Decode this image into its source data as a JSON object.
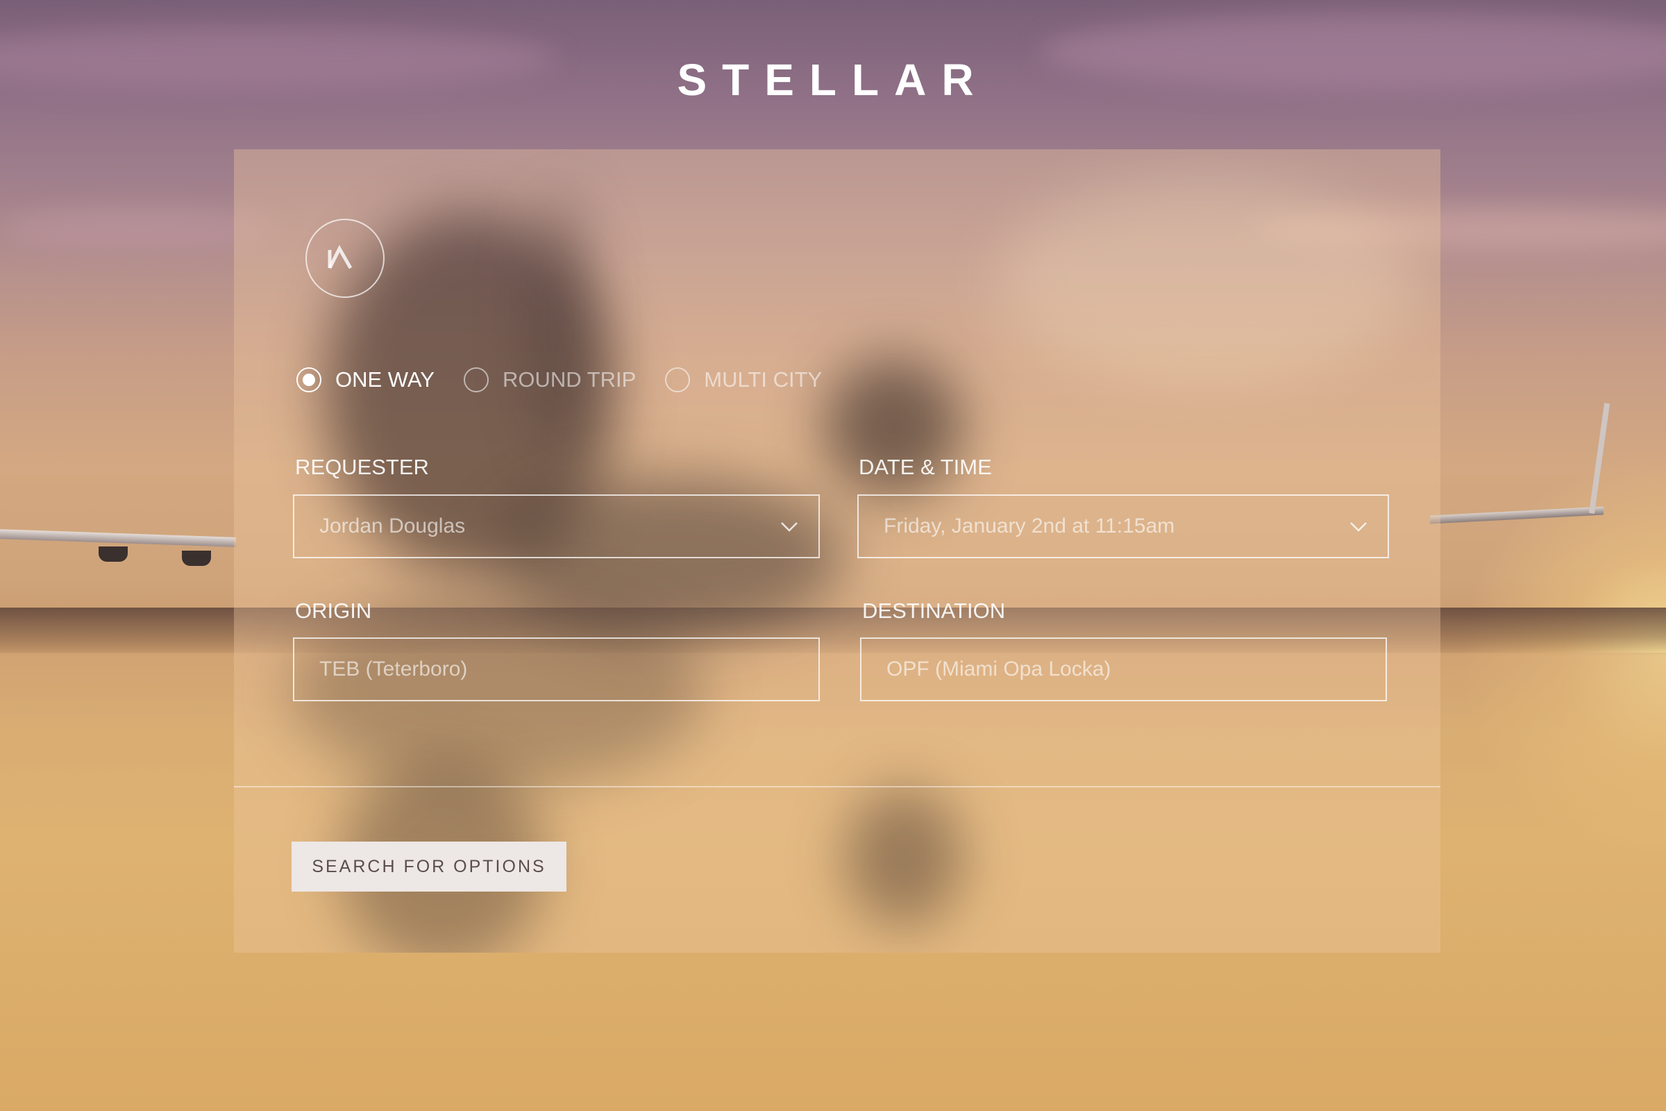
{
  "brand": {
    "logo_text": "STELLAR",
    "mark_icon": "stellar-chevron-mark"
  },
  "trip_type": {
    "options": [
      {
        "label": "ONE WAY",
        "selected": true
      },
      {
        "label": "ROUND TRIP",
        "selected": false
      },
      {
        "label": "MULTI CITY",
        "selected": false
      }
    ]
  },
  "form": {
    "requester": {
      "label": "REQUESTER",
      "value": "Jordan Douglas",
      "icon": "chevron-down-icon"
    },
    "datetime": {
      "label": "DATE & TIME",
      "value": "Friday, January 2nd at 11:15am",
      "icon": "chevron-down-icon"
    },
    "origin": {
      "label": "ORIGIN",
      "placeholder": "TEB (Teterboro)"
    },
    "destination": {
      "label": "DESTINATION",
      "placeholder": "OPF (Miami Opa Locka)"
    }
  },
  "actions": {
    "search_label": "SEARCH FOR OPTIONS"
  },
  "colors": {
    "card_overlay": "#eec8a0",
    "button_bg": "#ede7e5",
    "button_text": "#5a4d4a",
    "text": "#ffffff"
  }
}
